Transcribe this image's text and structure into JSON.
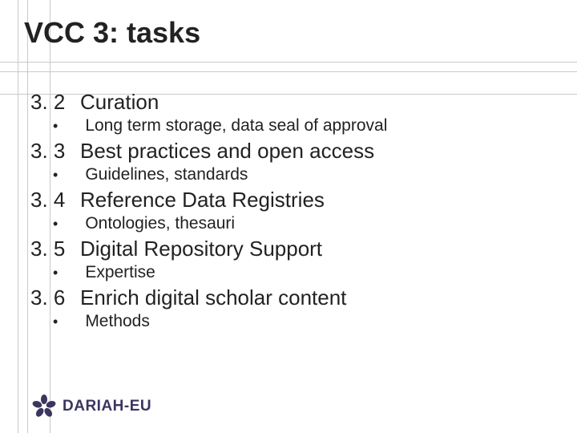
{
  "title": "VCC 3: tasks",
  "tasks": [
    {
      "num": "3. 2",
      "label": "Curation",
      "sub": "Long term storage, data seal of approval"
    },
    {
      "num": "3. 3",
      "label": "Best practices and open access",
      "sub": "Guidelines, standards"
    },
    {
      "num": "3. 4",
      "label": "Reference Data Registries",
      "sub": "Ontologies, thesauri"
    },
    {
      "num": "3. 5",
      "label": "Digital Repository Support",
      "sub": "Expertise"
    },
    {
      "num": "3. 6",
      "label": "Enrich digital scholar content",
      "sub": "Methods"
    }
  ],
  "footer": {
    "logo_text": "DARIAH-EU"
  }
}
